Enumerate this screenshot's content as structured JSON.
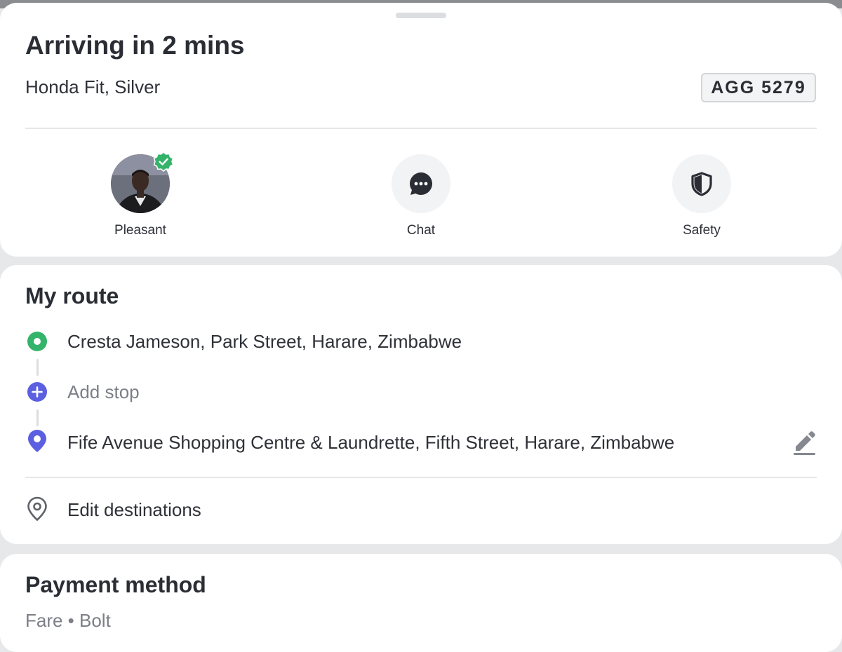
{
  "trip": {
    "title": "Arriving in 2 mins",
    "vehicle": "Honda Fit, Silver",
    "plate": "AGG 5279"
  },
  "actions": [
    {
      "label": "Pleasant",
      "icon": "driver-avatar"
    },
    {
      "label": "Chat",
      "icon": "chat-icon"
    },
    {
      "label": "Safety",
      "icon": "shield-icon"
    }
  ],
  "route": {
    "title": "My route",
    "pickup": "Cresta Jameson, Park Street, Harare, Zimbabwe",
    "add_stop": "Add stop",
    "destination": "Fife Avenue Shopping Centre & Laundrette, Fifth Street, Harare, Zimbabwe",
    "edit_destinations": "Edit destinations"
  },
  "payment": {
    "title": "Payment method",
    "subtitle": "Fare • Bolt"
  },
  "colors": {
    "pickup_green": "#34b36b",
    "stop_purple": "#5b5fe0",
    "verified_green": "#34b36b",
    "text_dark": "#2b2d35",
    "text_muted": "#7c7f87"
  }
}
